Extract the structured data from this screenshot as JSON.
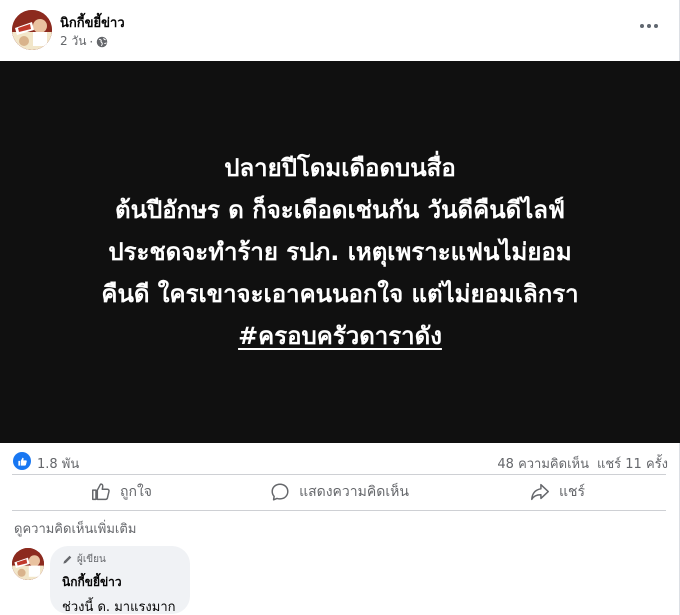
{
  "post": {
    "author": "นิกกี้ขยี้ข่าว",
    "time": "2 วัน",
    "separator": "·",
    "privacy_icon": "globe-icon",
    "more_icon": "more-horizontal-icon"
  },
  "image_text": {
    "line1": "ปลายปีโดมเดือดบนสื่อ",
    "line2": "ต้นปีอักษร ด ก็จะเดือดเช่นกัน วันดีคืนดีไลฟ์",
    "line3": "ประชดจะทำร้าย รปภ. เหตุเพราะแฟนไม่ยอม",
    "line4": "คืนดี ใครเขาจะเอาคนนอกใจ แต่ไม่ยอมเลิกรา",
    "hashtag": "#ครอบครัวดาราดัง"
  },
  "stats": {
    "reaction_icon": "like-icon",
    "reactions": "1.8 พัน",
    "comments": "48 ความคิดเห็น",
    "shares": "แชร์ 11 ครั้ง"
  },
  "actions": {
    "like": "ถูกใจ",
    "comment": "แสดงความคิดเห็น",
    "share": "แชร์"
  },
  "more_comments": "ดูความคิดเห็นเพิ่มเติม",
  "comment": {
    "badge": "ผู้เขียน",
    "author": "นิกกี้ขยี้ข่าว",
    "text": "ช่วงนี้ ด. มาแรงมาก"
  },
  "colors": {
    "brand_blue": "#1877f2",
    "secondary_text": "#65676b",
    "image_bg": "#101010"
  }
}
